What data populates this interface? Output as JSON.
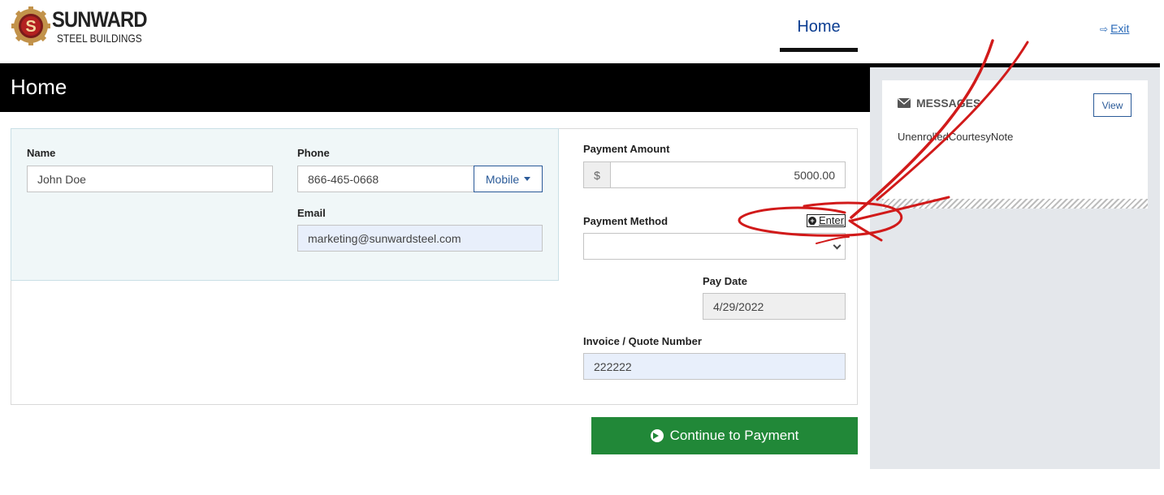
{
  "brand": {
    "name_line1": "SUNWARD",
    "name_line2": "STEEL BUILDINGS",
    "logo_letter": "S"
  },
  "nav": {
    "home_label": "Home",
    "exit_label": "Exit"
  },
  "page": {
    "title": "Home"
  },
  "contact": {
    "name_label": "Name",
    "name_value": "John Doe",
    "phone_label": "Phone",
    "phone_value": "866-465-0668",
    "phone_type": "Mobile",
    "email_label": "Email",
    "email_value": "marketing@sunwardsteel.com"
  },
  "payment": {
    "amount_label": "Payment Amount",
    "currency_symbol": "$",
    "amount_value": "5000.00",
    "method_label": "Payment Method",
    "enter_label": "Enter",
    "method_value": "",
    "pay_date_label": "Pay Date",
    "pay_date_value": "4/29/2022",
    "invoice_label": "Invoice / Quote Number",
    "invoice_value": "222222"
  },
  "actions": {
    "continue_label": "Continue to Payment"
  },
  "messages": {
    "title": "MESSAGES",
    "view_label": "View",
    "body": "UnenrolledCourtesyNote"
  },
  "colors": {
    "brand_blue": "#0b3d91",
    "link_blue": "#2a6ab8",
    "continue_green": "#218838",
    "annotation_red": "#d11a1a"
  }
}
